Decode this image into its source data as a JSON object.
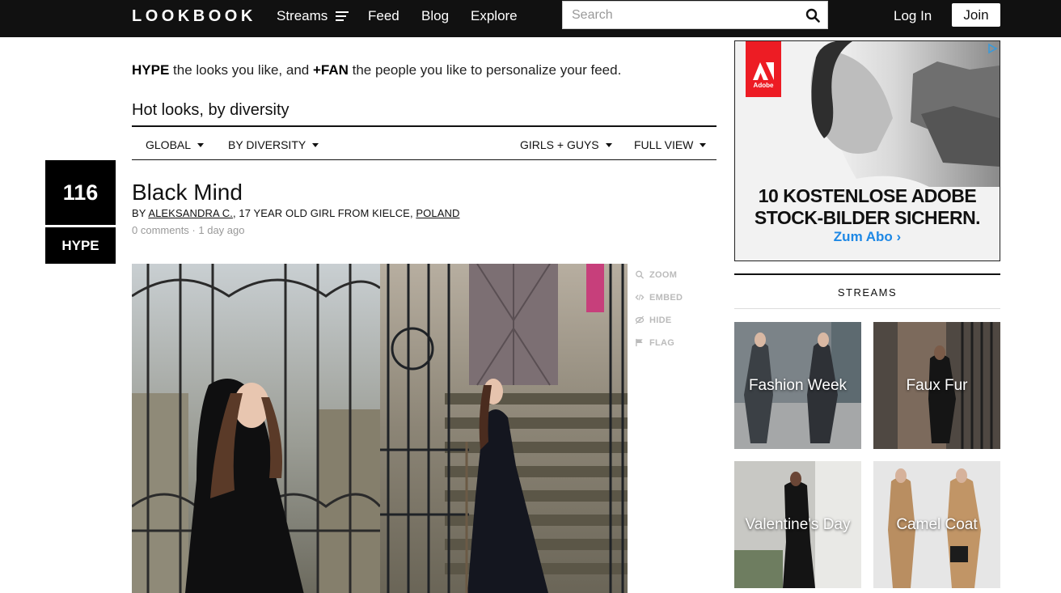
{
  "nav": {
    "logo": "LOOKBOOK",
    "streams": "Streams",
    "feed": "Feed",
    "blog": "Blog",
    "explore": "Explore",
    "search_placeholder": "Search",
    "login": "Log In",
    "join": "Join"
  },
  "intro": {
    "hype_word": "HYPE",
    "part1": " the looks you like, and ",
    "fan_word": "+FAN",
    "part2": " the people you like to personalize your feed."
  },
  "section_title": "Hot looks, by diversity",
  "filters": {
    "global": "GLOBAL",
    "by_diversity": "BY DIVERSITY",
    "gender": "GIRLS + GUYS",
    "view": "FULL VIEW"
  },
  "look": {
    "hype_count": "116",
    "hype_label": "HYPE",
    "title": "Black Mind",
    "by": "BY",
    "author": "ALEKSANDRA C.",
    "author_desc": ", 17 YEAR OLD GIRL FROM KIELCE, ",
    "country": "POLAND",
    "comments": "0 comments",
    "separator": " · ",
    "time": "1 day ago"
  },
  "actions": {
    "zoom": "ZOOM",
    "embed": "EMBED",
    "hide": "HIDE",
    "flag": "FLAG"
  },
  "ad": {
    "brand": "Adobe",
    "line1": "10 KOSTENLOSE ADOBE",
    "line2": "STOCK-BILDER SICHERN.",
    "cta": "Zum Abo ›"
  },
  "streams": {
    "heading": "STREAMS",
    "tiles": [
      {
        "label": "Fashion Week"
      },
      {
        "label": "Faux Fur"
      },
      {
        "label": "Valentine's Day"
      },
      {
        "label": "Camel Coat"
      }
    ]
  },
  "colors": {
    "topbar": "#111111",
    "accent_link": "#1e88e5",
    "adobe_red": "#ed1c24"
  }
}
